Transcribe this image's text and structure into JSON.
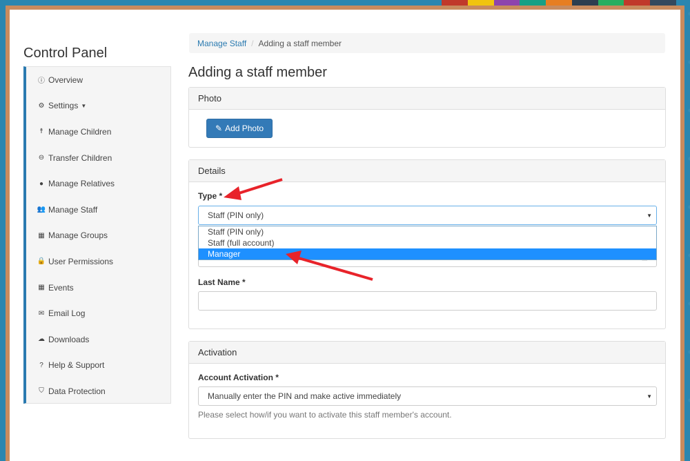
{
  "sidebar": {
    "title": "Control Panel",
    "items": [
      {
        "label": "Overview",
        "icon": "ⓘ"
      },
      {
        "label": "Settings",
        "icon": "⚙"
      },
      {
        "label": "Manage Children",
        "icon": "☨"
      },
      {
        "label": "Transfer Children",
        "icon": "⊖"
      },
      {
        "label": "Manage Relatives",
        "icon": "●"
      },
      {
        "label": "Manage Staff",
        "icon": "👥"
      },
      {
        "label": "Manage Groups",
        "icon": "▦"
      },
      {
        "label": "User Permissions",
        "icon": "🔒"
      },
      {
        "label": "Events",
        "icon": "▦"
      },
      {
        "label": "Email Log",
        "icon": "✉"
      },
      {
        "label": "Downloads",
        "icon": "☁"
      },
      {
        "label": "Help & Support",
        "icon": "?"
      },
      {
        "label": "Data Protection",
        "icon": "⛉"
      }
    ]
  },
  "breadcrumb": {
    "link": "Manage Staff",
    "current": "Adding a staff member"
  },
  "main": {
    "title": "Adding a staff member",
    "photo": {
      "heading": "Photo",
      "button_icon": "✎",
      "button_label": "Add Photo"
    },
    "details": {
      "heading": "Details",
      "type_label": "Type",
      "type_value": "Staff (PIN only)",
      "type_options": [
        "Staff (PIN only)",
        "Staff (full account)",
        "Manager"
      ],
      "last_name_label": "Last Name",
      "last_name_value": ""
    },
    "activation": {
      "heading": "Activation",
      "label": "Account Activation",
      "value": "Manually enter the PIN and make active immediately",
      "help": "Please select how/if you want to activate this staff member's account."
    }
  },
  "required_marker": "*",
  "colors": {
    "accent": "#337ab7",
    "sidebar_border": "#2a7ab0",
    "dropdown_highlight": "#1e90ff",
    "annotation_arrow": "#e8232a"
  }
}
